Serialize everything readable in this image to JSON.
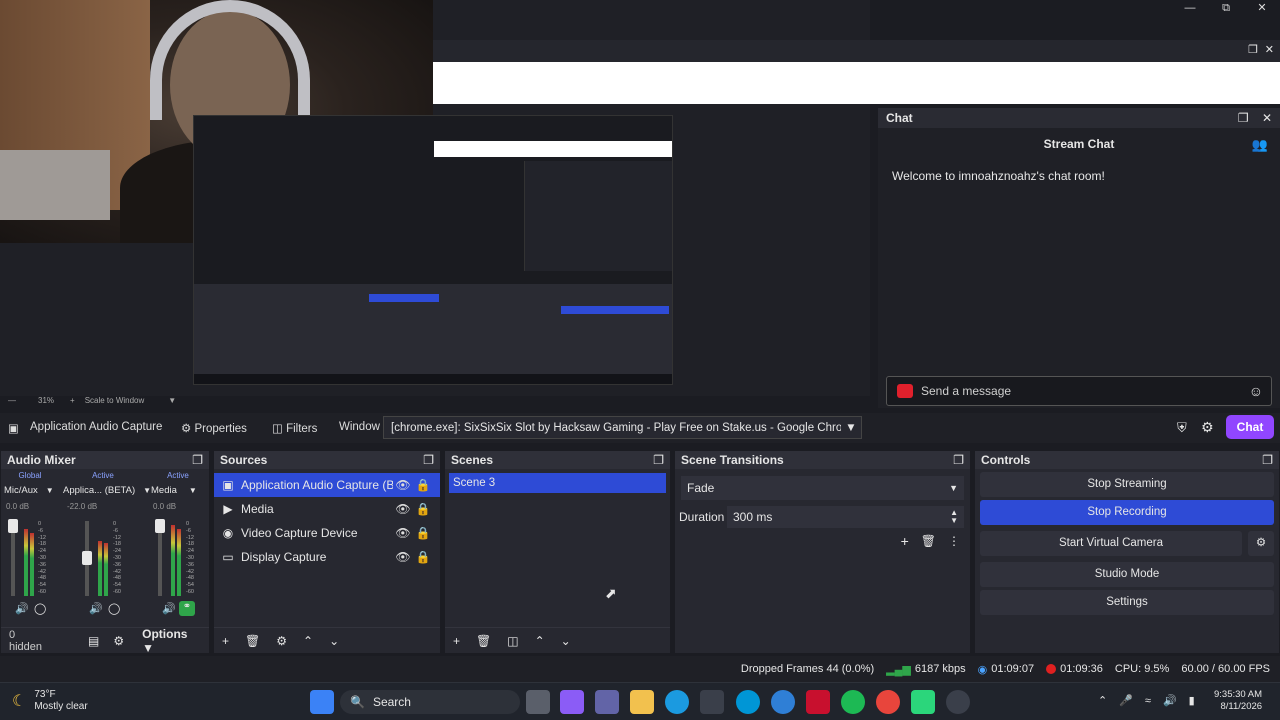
{
  "preview": {
    "zoom": "31%",
    "zoom_mode": "Scale to Window"
  },
  "chat": {
    "header": "Chat",
    "title": "Stream Chat",
    "welcome": "Welcome to imnoahznoahz's chat room!",
    "input_placeholder": "Send a message",
    "chat_button": "Chat"
  },
  "source_toolbar": {
    "source_name": "Application Audio Capture",
    "properties": "Properties",
    "filters": "Filters",
    "window_label": "Window",
    "window_value": "[chrome.exe]: SixSixSix Slot by Hacksaw Gaming - Play Free on Stake.us - Google Chrome"
  },
  "audio_mixer": {
    "title": "Audio Mixer",
    "channels": [
      {
        "scope": "Global",
        "name": "Mic/Aux",
        "db": "0.0 dB",
        "level": 1.0
      },
      {
        "scope": "Active",
        "name": "Applica... (BETA)",
        "db": "-22.0 dB",
        "level": 0.6
      },
      {
        "scope": "Active",
        "name": "Media",
        "db": "0.0 dB",
        "level": 1.0
      }
    ],
    "scale": [
      "0",
      "-6",
      "-12",
      "-18",
      "-24",
      "-30",
      "-36",
      "-42",
      "-48",
      "-54",
      "-60"
    ],
    "hidden": "0 hidden",
    "options": "Options"
  },
  "sources": {
    "title": "Sources",
    "items": [
      {
        "name": "Application Audio Capture (BETA)",
        "icon": "audio-icon",
        "selected": true
      },
      {
        "name": "Media",
        "icon": "play-icon",
        "selected": false
      },
      {
        "name": "Video Capture Device",
        "icon": "camera-icon",
        "selected": false
      },
      {
        "name": "Display Capture",
        "icon": "monitor-icon",
        "selected": false
      }
    ]
  },
  "scenes": {
    "title": "Scenes",
    "items": [
      "Scene 3"
    ]
  },
  "transitions": {
    "title": "Scene Transitions",
    "type": "Fade",
    "duration_label": "Duration",
    "duration_value": "300 ms"
  },
  "controls": {
    "title": "Controls",
    "stop_streaming": "Stop Streaming",
    "stop_recording": "Stop Recording",
    "start_virtual_camera": "Start Virtual Camera",
    "studio_mode": "Studio Mode",
    "settings": "Settings"
  },
  "status": {
    "dropped_frames": "Dropped Frames 44 (0.0%)",
    "bitrate": "6187 kbps",
    "stream_time": "01:09:07",
    "rec_time": "01:09:36",
    "cpu": "CPU: 9.5%",
    "fps": "60.00 / 60.00 FPS"
  },
  "taskbar": {
    "weather_temp": "73°F",
    "weather_desc": "Mostly clear",
    "search": "Search",
    "time": "9:35:30 AM",
    "date": "8/11/2026"
  },
  "colors": {
    "accent_blue": "#2e4bd6",
    "twitch_purple": "#9146ff",
    "rec_red": "#e02020"
  }
}
